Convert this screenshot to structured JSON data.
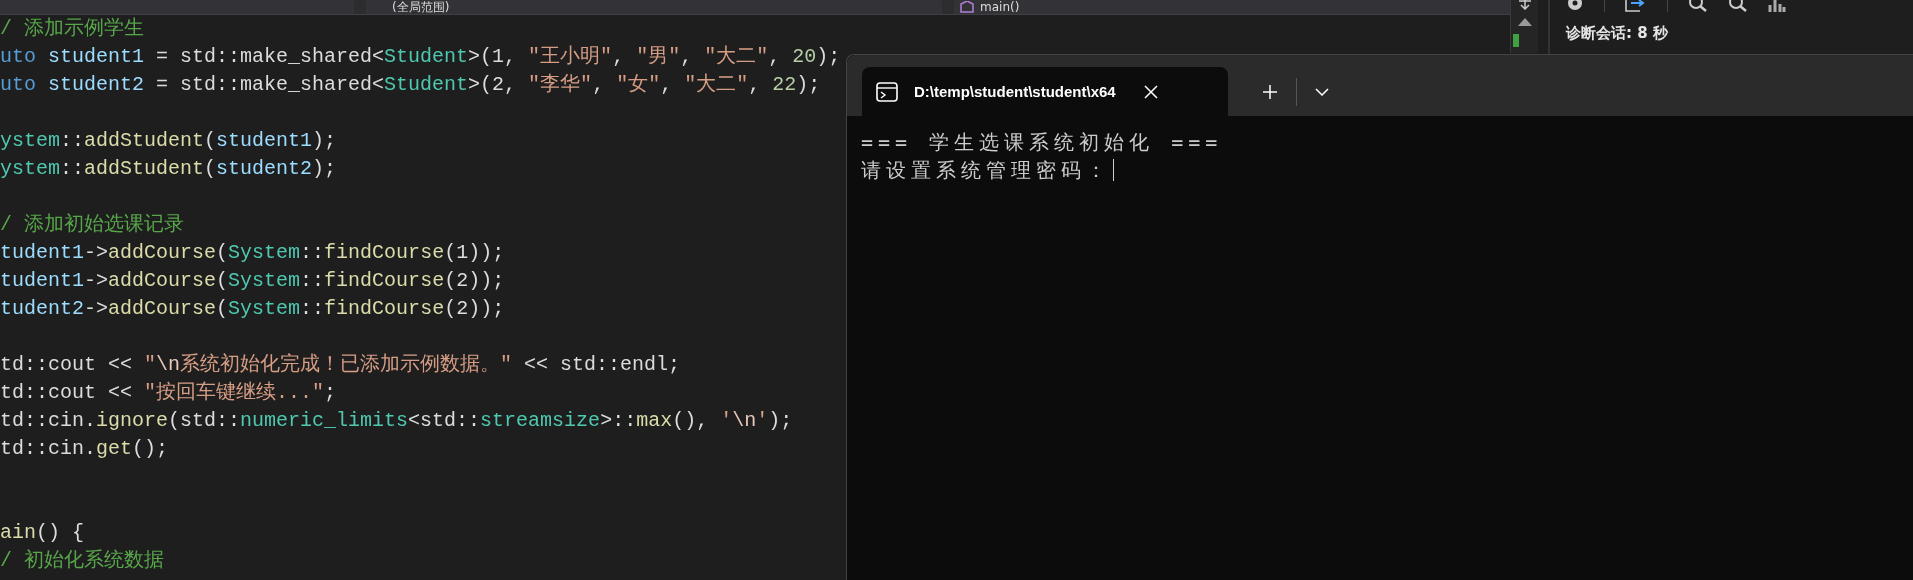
{
  "editor": {
    "scope_dropdowns": [
      {
        "kind": "scope",
        "label": "(全局范围)"
      },
      {
        "kind": "function",
        "label": "main()"
      }
    ],
    "code_lines": [
      {
        "kind": "code",
        "tokens": [
          {
            "kind": "comment",
            "text": "/ 添加示例学生"
          }
        ]
      },
      {
        "kind": "code",
        "tokens": [
          {
            "kind": "keyword",
            "text": "uto "
          },
          {
            "kind": "var",
            "text": "student1"
          },
          {
            "kind": "plain",
            "text": " = std::make_shared<"
          },
          {
            "kind": "type",
            "text": "Student"
          },
          {
            "kind": "plain",
            "text": ">(1, "
          },
          {
            "kind": "string",
            "text": "\"王小明\""
          },
          {
            "kind": "plain",
            "text": ", "
          },
          {
            "kind": "string",
            "text": "\"男\""
          },
          {
            "kind": "plain",
            "text": ", "
          },
          {
            "kind": "string",
            "text": "\"大二\""
          },
          {
            "kind": "plain",
            "text": ", "
          },
          {
            "kind": "number",
            "text": "20"
          },
          {
            "kind": "plain",
            "text": ");"
          }
        ]
      },
      {
        "kind": "code",
        "tokens": [
          {
            "kind": "keyword",
            "text": "uto "
          },
          {
            "kind": "var",
            "text": "student2"
          },
          {
            "kind": "plain",
            "text": " = std::make_shared<"
          },
          {
            "kind": "type",
            "text": "Student"
          },
          {
            "kind": "plain",
            "text": ">(2, "
          },
          {
            "kind": "string",
            "text": "\"李华\""
          },
          {
            "kind": "plain",
            "text": ", "
          },
          {
            "kind": "string",
            "text": "\"女\""
          },
          {
            "kind": "plain",
            "text": ", "
          },
          {
            "kind": "string",
            "text": "\"大二\""
          },
          {
            "kind": "plain",
            "text": ", "
          },
          {
            "kind": "number",
            "text": "22"
          },
          {
            "kind": "plain",
            "text": ");"
          }
        ]
      },
      {
        "kind": "blank"
      },
      {
        "kind": "code",
        "tokens": [
          {
            "kind": "type",
            "text": "ystem"
          },
          {
            "kind": "plain",
            "text": "::"
          },
          {
            "kind": "func",
            "text": "addStudent"
          },
          {
            "kind": "plain",
            "text": "("
          },
          {
            "kind": "var",
            "text": "student1"
          },
          {
            "kind": "plain",
            "text": ");"
          }
        ]
      },
      {
        "kind": "code",
        "tokens": [
          {
            "kind": "type",
            "text": "ystem"
          },
          {
            "kind": "plain",
            "text": "::"
          },
          {
            "kind": "func",
            "text": "addStudent"
          },
          {
            "kind": "plain",
            "text": "("
          },
          {
            "kind": "var",
            "text": "student2"
          },
          {
            "kind": "plain",
            "text": ");"
          }
        ]
      },
      {
        "kind": "blank"
      },
      {
        "kind": "code",
        "tokens": [
          {
            "kind": "comment",
            "text": "/ 添加初始选课记录"
          }
        ]
      },
      {
        "kind": "code",
        "tokens": [
          {
            "kind": "var",
            "text": "tudent1"
          },
          {
            "kind": "plain",
            "text": "->"
          },
          {
            "kind": "func",
            "text": "addCourse"
          },
          {
            "kind": "plain",
            "text": "("
          },
          {
            "kind": "type",
            "text": "System"
          },
          {
            "kind": "plain",
            "text": "::"
          },
          {
            "kind": "func",
            "text": "findCourse"
          },
          {
            "kind": "plain",
            "text": "(1));"
          }
        ]
      },
      {
        "kind": "code",
        "tokens": [
          {
            "kind": "var",
            "text": "tudent1"
          },
          {
            "kind": "plain",
            "text": "->"
          },
          {
            "kind": "func",
            "text": "addCourse"
          },
          {
            "kind": "plain",
            "text": "("
          },
          {
            "kind": "type",
            "text": "System"
          },
          {
            "kind": "plain",
            "text": "::"
          },
          {
            "kind": "func",
            "text": "findCourse"
          },
          {
            "kind": "plain",
            "text": "(2));"
          }
        ]
      },
      {
        "kind": "code",
        "tokens": [
          {
            "kind": "var",
            "text": "tudent2"
          },
          {
            "kind": "plain",
            "text": "->"
          },
          {
            "kind": "func",
            "text": "addCourse"
          },
          {
            "kind": "plain",
            "text": "("
          },
          {
            "kind": "type",
            "text": "System"
          },
          {
            "kind": "plain",
            "text": "::"
          },
          {
            "kind": "func",
            "text": "findCourse"
          },
          {
            "kind": "plain",
            "text": "(2));"
          }
        ]
      },
      {
        "kind": "blank"
      },
      {
        "kind": "code",
        "tokens": [
          {
            "kind": "plain",
            "text": "td::cout << "
          },
          {
            "kind": "string",
            "text": "\""
          },
          {
            "kind": "escape",
            "text": "\\n"
          },
          {
            "kind": "string",
            "text": "系统初始化完成！已添加示例数据。\""
          },
          {
            "kind": "plain",
            "text": " << std::endl;"
          }
        ]
      },
      {
        "kind": "code",
        "tokens": [
          {
            "kind": "plain",
            "text": "td::cout << "
          },
          {
            "kind": "string",
            "text": "\"按回车键继续...\""
          },
          {
            "kind": "plain",
            "text": ";"
          }
        ]
      },
      {
        "kind": "code",
        "tokens": [
          {
            "kind": "plain",
            "text": "td::cin."
          },
          {
            "kind": "func",
            "text": "ignore"
          },
          {
            "kind": "plain",
            "text": "(std::"
          },
          {
            "kind": "type",
            "text": "numeric_limits"
          },
          {
            "kind": "plain",
            "text": "<std::"
          },
          {
            "kind": "type",
            "text": "streamsize"
          },
          {
            "kind": "plain",
            "text": ">::"
          },
          {
            "kind": "func",
            "text": "max"
          },
          {
            "kind": "plain",
            "text": "(), "
          },
          {
            "kind": "string",
            "text": "'"
          },
          {
            "kind": "escape",
            "text": "\\n"
          },
          {
            "kind": "string",
            "text": "'"
          },
          {
            "kind": "plain",
            "text": ");"
          }
        ]
      },
      {
        "kind": "code",
        "tokens": [
          {
            "kind": "plain",
            "text": "td::cin."
          },
          {
            "kind": "func",
            "text": "get"
          },
          {
            "kind": "plain",
            "text": "();"
          }
        ]
      },
      {
        "kind": "blank"
      },
      {
        "kind": "blank"
      },
      {
        "kind": "code",
        "tokens": [
          {
            "kind": "func",
            "text": "ain"
          },
          {
            "kind": "plain",
            "text": "() {"
          }
        ]
      },
      {
        "kind": "code",
        "tokens": [
          {
            "kind": "comment",
            "text": "/ 初始化系统数据"
          }
        ]
      }
    ]
  },
  "diagnostics": {
    "session_label": "诊断会话: 8 秒"
  },
  "terminal": {
    "tab_title": "D:\\temp\\student\\student\\x64",
    "lines": [
      "=== 学生选课系统初始化 ===",
      "请设置系统管理密码："
    ],
    "cursor": true
  }
}
